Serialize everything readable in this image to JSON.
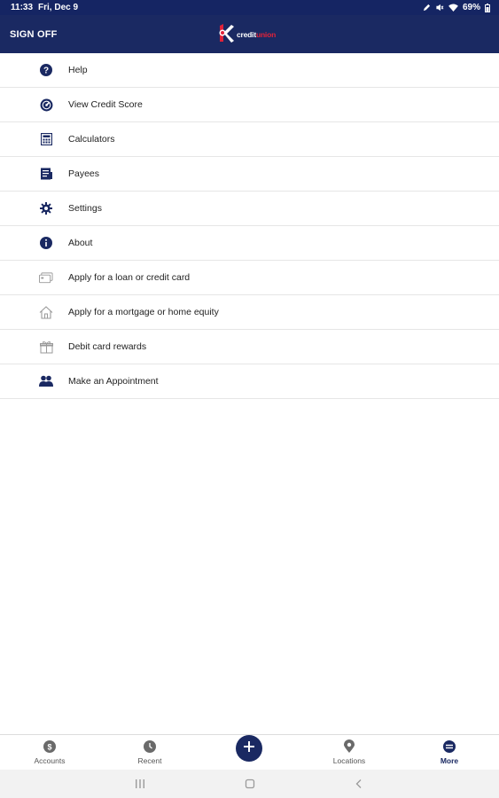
{
  "status_bar": {
    "time": "11:33",
    "date": "Fri, Dec 9",
    "battery": "69%"
  },
  "header": {
    "sign_off_label": "SIGN OFF",
    "logo_text_primary": "credit",
    "logo_text_accent": "union",
    "brand_color": "#1a2962",
    "accent_color": "#e0223a"
  },
  "menu": {
    "items": [
      {
        "label": "Help",
        "icon": "help-icon"
      },
      {
        "label": "View Credit Score",
        "icon": "credit-score-icon"
      },
      {
        "label": "Calculators",
        "icon": "calculator-icon"
      },
      {
        "label": "Payees",
        "icon": "payees-icon"
      },
      {
        "label": "Settings",
        "icon": "gear-icon"
      },
      {
        "label": "About",
        "icon": "info-icon"
      },
      {
        "label": "Apply for a loan or credit card",
        "icon": "credit-card-icon"
      },
      {
        "label": "Apply for a mortgage or home equity",
        "icon": "home-icon"
      },
      {
        "label": "Debit card rewards",
        "icon": "gift-icon"
      },
      {
        "label": "Make an Appointment",
        "icon": "people-icon"
      }
    ]
  },
  "bottom_nav": {
    "items": [
      {
        "label": "Accounts",
        "icon": "accounts-icon",
        "active": false
      },
      {
        "label": "Recent",
        "icon": "recent-icon",
        "active": false
      },
      {
        "label": "Locations",
        "icon": "location-pin-icon",
        "active": false
      },
      {
        "label": "More",
        "icon": "more-icon",
        "active": true
      }
    ],
    "fab_icon": "plus-icon"
  }
}
